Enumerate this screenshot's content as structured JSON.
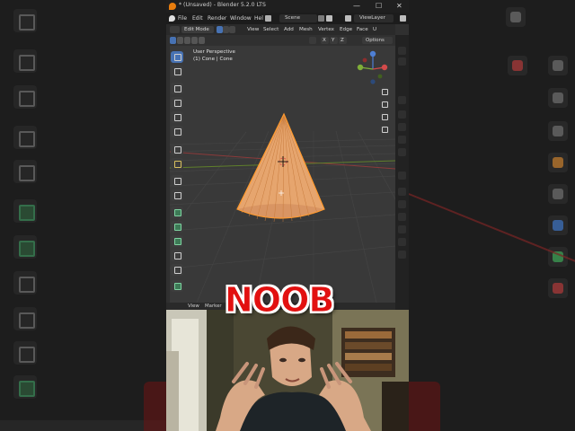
{
  "window": {
    "title": "* (Unsaved) - Blender 5.2.0 LTS",
    "minimize": "—",
    "maximize": "☐",
    "close": "✕"
  },
  "menubar": {
    "items": [
      "File",
      "Edit",
      "Render",
      "Window",
      "Hel"
    ],
    "scene": "Scene",
    "view_layer": "ViewLayer"
  },
  "viewport_header": {
    "mode": "Edit Mode",
    "menus": [
      "View",
      "Select",
      "Add",
      "Mesh",
      "Vertex",
      "Edge",
      "Face",
      "U"
    ],
    "axes": [
      "X",
      "Y",
      "Z"
    ],
    "options": "Options"
  },
  "viewport": {
    "perspective": "User Perspective",
    "object": "(1) Cone | Cone"
  },
  "timeline": {
    "items": [
      "View",
      "Marker"
    ]
  },
  "overlay": {
    "caption": "NOOB"
  },
  "colors": {
    "mesh_fill": "#e8a46a",
    "mesh_edge": "#ff9a2e",
    "accent_blue": "#4772b3",
    "axis_red": "#c0393b",
    "axis_green": "#6aa22f",
    "caption_red": "#e21010"
  }
}
